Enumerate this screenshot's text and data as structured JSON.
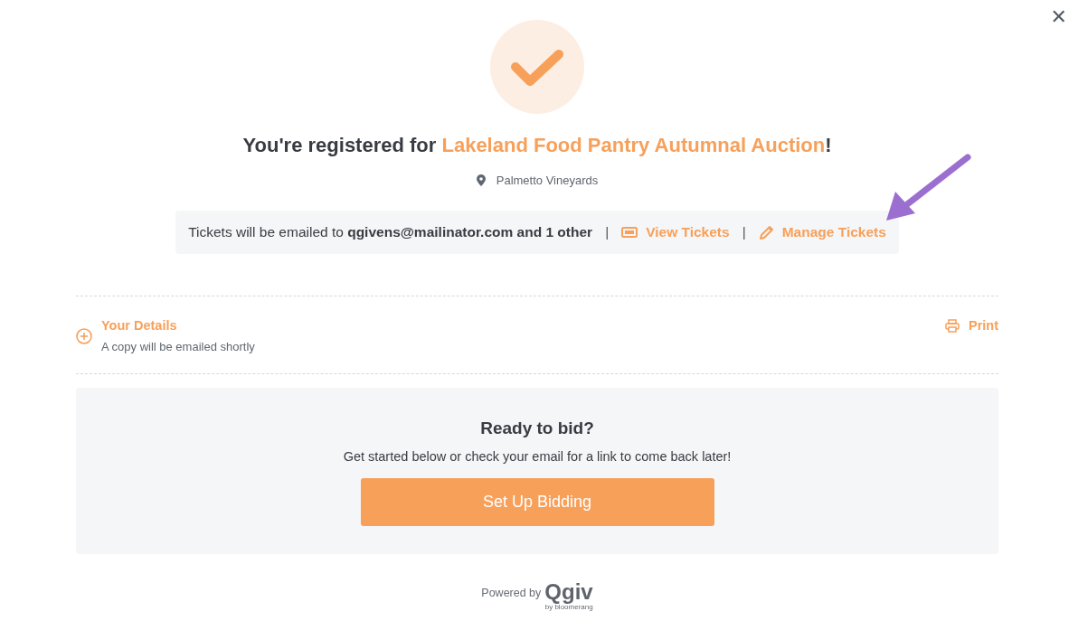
{
  "close_button": {
    "label": "✕"
  },
  "confirmation": {
    "title_prefix": "You're registered for ",
    "event_name": "Lakeland Food Pantry Autumnal Auction",
    "title_suffix": "!",
    "venue": "Palmetto Vineyards"
  },
  "tickets_bar": {
    "message": "Tickets will be emailed to **qgivens@mailinator.com and 1 other**",
    "separator": "|",
    "links": [
      {
        "kind": "ticket",
        "label": "View Tickets"
      },
      {
        "kind": "edit",
        "label": "Manage Tickets"
      }
    ]
  },
  "details": {
    "title": "Your Details",
    "subtitle": "A copy will be emailed shortly",
    "expanded": false,
    "print_label": "Print"
  },
  "bid_panel": {
    "title": "Ready to bid?",
    "text": "Get started below or check your email for a link to come back later!",
    "button": "Set Up Bidding"
  },
  "footer": {
    "powered_by": "Powered by",
    "logo": "Qgiv",
    "logo_sub": "by bloomerang"
  }
}
